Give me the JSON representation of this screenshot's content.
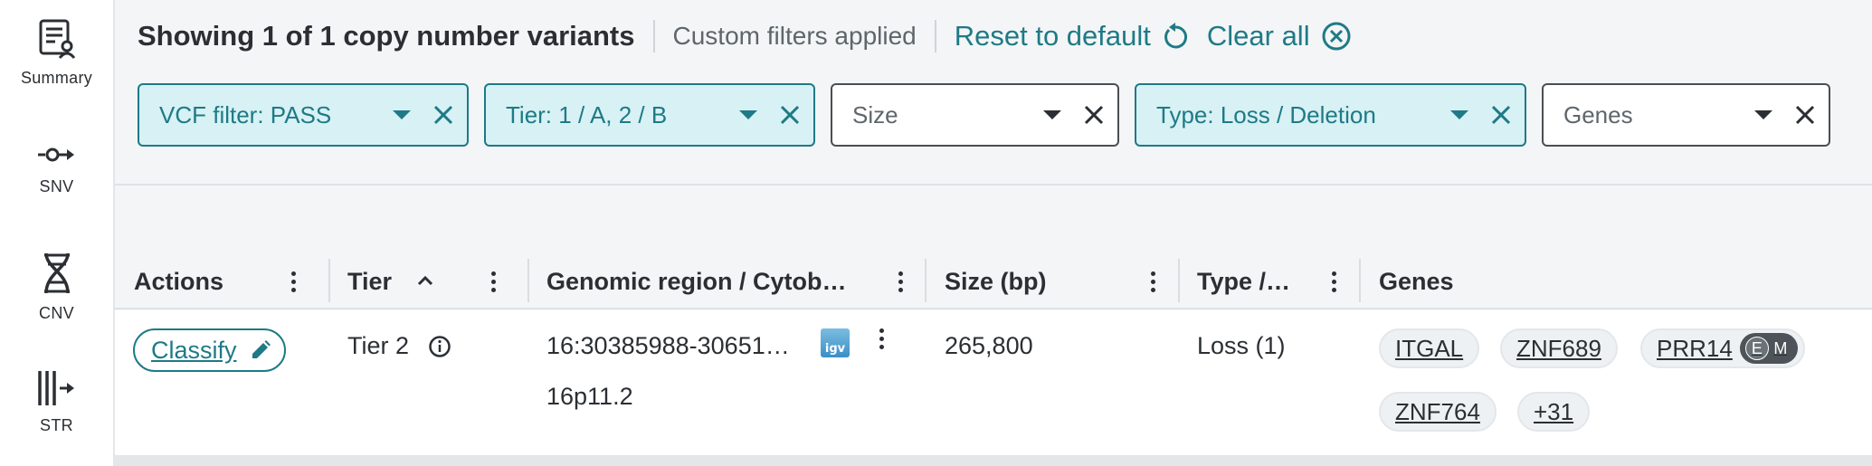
{
  "sidebar": {
    "items": [
      {
        "label": "Summary",
        "icon": "summary-icon"
      },
      {
        "label": "SNV",
        "icon": "snv-icon"
      },
      {
        "label": "CNV",
        "icon": "dna-icon"
      },
      {
        "label": "STR",
        "icon": "str-icon"
      }
    ]
  },
  "summary": {
    "title": "Showing 1 of 1 copy number variants",
    "subtitle": "Custom filters applied",
    "reset_label": "Reset to default",
    "clear_label": "Clear all"
  },
  "filters": [
    {
      "label": "VCF filter: PASS",
      "active": true
    },
    {
      "label": "Tier: 1 / A, 2 / B",
      "active": true
    },
    {
      "label": "Size",
      "active": false
    },
    {
      "label": "Type: Loss / Deletion",
      "active": true
    },
    {
      "label": "Genes",
      "active": false
    }
  ],
  "table": {
    "headers": [
      "Actions",
      "Tier",
      "Genomic region / Cytob…",
      "Size (bp)",
      "Type /…",
      "Genes"
    ],
    "rows": [
      {
        "action": "Classify",
        "tier": "Tier 2",
        "region": "16:30385988-30651…",
        "cytoband": "16p11.2",
        "igv": "igv",
        "size": "265,800",
        "type": "Loss (1)",
        "genes": [
          "ITGAL",
          "ZNF689",
          "PRR14",
          "ZNF764",
          "+31"
        ],
        "badges": [
          "E",
          "M"
        ]
      }
    ]
  },
  "colors": {
    "accent": "#1e7a86",
    "active_chip_bg": "#d7f1f4",
    "background": "#f3f5f6"
  }
}
